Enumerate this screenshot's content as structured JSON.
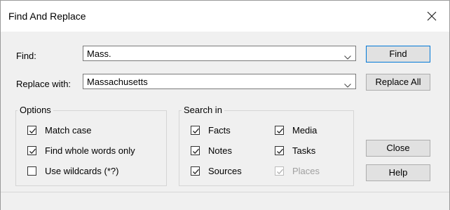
{
  "dialog": {
    "title": "Find And Replace",
    "close_icon": "close-icon"
  },
  "find": {
    "label": "Find:",
    "value": "Mass.",
    "dropdown_icon": "chevron-down-icon"
  },
  "replace": {
    "label": "Replace with:",
    "value": "Massachusetts",
    "dropdown_icon": "chevron-down-icon"
  },
  "buttons": {
    "find": "Find",
    "replace_all": "Replace All",
    "close": "Close",
    "help": "Help"
  },
  "options": {
    "title": "Options",
    "items": [
      {
        "label": "Match case",
        "checked": true
      },
      {
        "label": "Find whole words only",
        "checked": true
      },
      {
        "label": "Use wildcards (*?)",
        "checked": false
      }
    ]
  },
  "search_in": {
    "title": "Search in",
    "items": [
      {
        "label": "Facts",
        "checked": true,
        "enabled": true
      },
      {
        "label": "Notes",
        "checked": true,
        "enabled": true
      },
      {
        "label": "Sources",
        "checked": true,
        "enabled": true
      },
      {
        "label": "Media",
        "checked": true,
        "enabled": true
      },
      {
        "label": "Tasks",
        "checked": true,
        "enabled": true
      },
      {
        "label": "Places",
        "checked": true,
        "enabled": false
      }
    ]
  },
  "colors": {
    "accent": "#0078d7",
    "dialog_bg": "#f0f0f0",
    "disabled_text": "#a0a0a0"
  }
}
